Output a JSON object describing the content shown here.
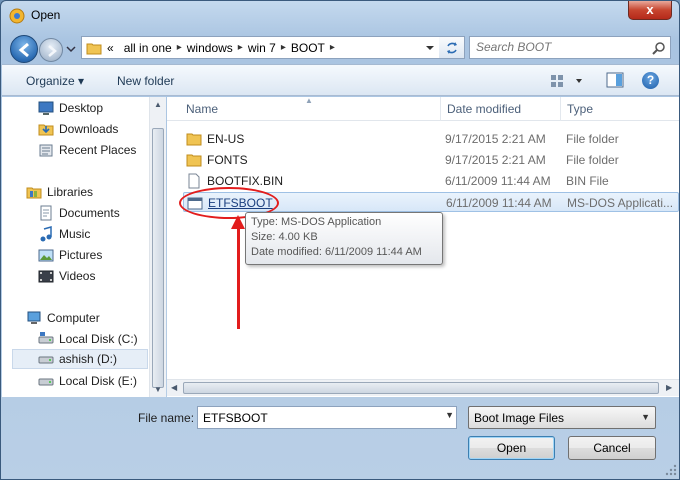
{
  "window": {
    "title": "Open",
    "close_label": "x"
  },
  "address": {
    "crumbs": [
      "«",
      "all in one",
      "windows",
      "win 7",
      "BOOT"
    ],
    "search_placeholder": "Search BOOT"
  },
  "toolbar": {
    "organize_label": "Organize ▾",
    "new_folder_label": "New folder",
    "help_label": "?"
  },
  "nav": {
    "items": [
      {
        "label": "Desktop",
        "icon": "desktop-icon"
      },
      {
        "label": "Downloads",
        "icon": "downloads-icon"
      },
      {
        "label": "Recent Places",
        "icon": "recent-places-icon"
      },
      {
        "label": "Libraries",
        "icon": "libraries-icon"
      },
      {
        "label": "Documents",
        "icon": "documents-icon"
      },
      {
        "label": "Music",
        "icon": "music-icon"
      },
      {
        "label": "Pictures",
        "icon": "pictures-icon"
      },
      {
        "label": "Videos",
        "icon": "videos-icon"
      },
      {
        "label": "Computer",
        "icon": "computer-icon"
      },
      {
        "label": "Local Disk (C:)",
        "icon": "drive-icon"
      },
      {
        "label": "ashish (D:)",
        "icon": "drive-icon"
      },
      {
        "label": "Local Disk (E:)",
        "icon": "drive-icon"
      }
    ]
  },
  "files": {
    "columns": [
      "Name",
      "Date modified",
      "Type"
    ],
    "rows": [
      {
        "name": "EN-US",
        "date": "9/17/2015 2:21 AM",
        "type": "File folder",
        "icon": "folder-icon"
      },
      {
        "name": "FONTS",
        "date": "9/17/2015 2:21 AM",
        "type": "File folder",
        "icon": "folder-icon"
      },
      {
        "name": "BOOTFIX.BIN",
        "date": "6/11/2009 11:44 AM",
        "type": "BIN File",
        "icon": "file-icon"
      },
      {
        "name": "ETFSBOOT",
        "date": "6/11/2009 11:44 AM",
        "type": "MS-DOS Applicati...",
        "icon": "msdos-app-icon"
      }
    ],
    "tooltip": {
      "type": "Type: MS-DOS Application",
      "size": "Size: 4.00 KB",
      "date": "Date modified: 6/11/2009 11:44 AM"
    }
  },
  "footer": {
    "filename_label": "File name:",
    "filename_value": "ETFSBOOT",
    "filetype_value": "Boot Image Files",
    "open_label": "Open",
    "cancel_label": "Cancel"
  },
  "colors": {
    "annotation": "#e21d1d",
    "selection": "#d7e7f8",
    "close": "#c7452f"
  }
}
